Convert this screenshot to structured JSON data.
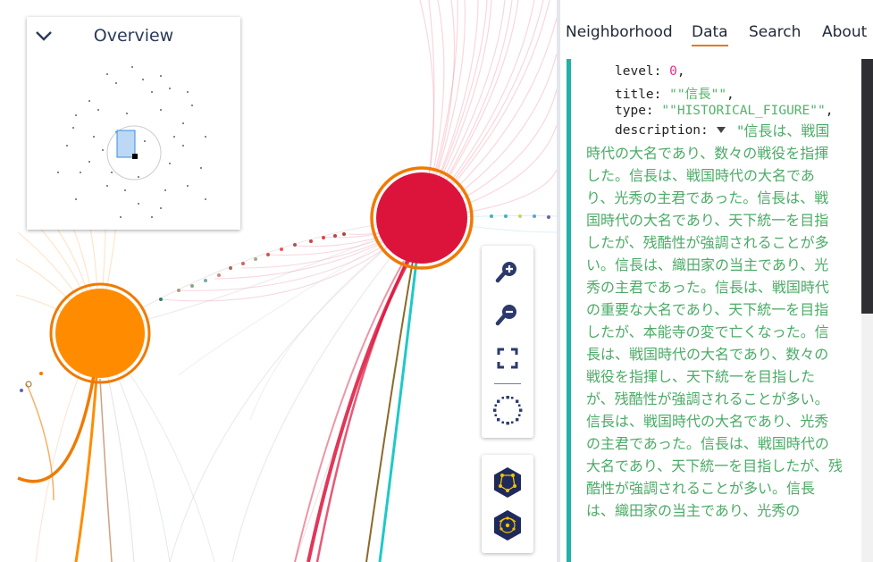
{
  "overview": {
    "title": "Overview",
    "collapse_icon": "chevron-down-icon"
  },
  "graph": {
    "nodes": [
      {
        "name": "orange-node",
        "color": "#ff8c00",
        "ring": "#f07a00"
      },
      {
        "name": "red-node",
        "color": "#dc143c",
        "ring": "#f07a00"
      }
    ]
  },
  "controls": {
    "zoom_in_icon": "zoom-in-icon",
    "zoom_out_icon": "zoom-out-icon",
    "fit_icon": "fit-screen-icon",
    "rotate_icon": "layout-spinner-icon",
    "layout1_icon": "force-layout-icon",
    "layout2_icon": "radial-layout-icon"
  },
  "tabs": [
    {
      "label": "Neighborhood",
      "active": false
    },
    {
      "label": "Data",
      "active": true
    },
    {
      "label": "Search",
      "active": false
    },
    {
      "label": "About",
      "active": false
    }
  ],
  "data_panel": {
    "level_key": "level:",
    "level_value": "0",
    "level_comma": ",",
    "title_key": "title:",
    "title_value": "\"\"信長\"\"",
    "title_comma": ",",
    "type_key": "type:",
    "type_value": "\"\"HISTORICAL_FIGURE\"\"",
    "type_comma": ",",
    "description_key": "description:",
    "description_value": "\"信長は、戦国時代の大名であり、数々の戦役を指揮した。信長は、戦国時代の大名であり、光秀の主君であった。信長は、戦国時代の大名であり、天下統一を目指したが、残酷性が強調されることが多い。信長は、織田家の当主であり、光秀の主君であった。信長は、戦国時代の重要な大名であり、天下統一を目指したが、本能寺の変で亡くなった。信長は、戦国時代の大名であり、数々の戦役を指揮し、天下統一を目指したが、残酷性が強調されることが多い。信長は、戦国時代の大名であり、光秀の主君であった。信長は、戦国時代の大名であり、天下統一を目指したが、残酷性が強調されることが多い。信長は、織田家の当主であり、光秀の"
  },
  "colors": {
    "accent": "#21b1a6",
    "tab_underline": "#e07a2b",
    "string_green": "#4cab67",
    "number_pink": "#e0308a",
    "icon_navy": "#2b3a6b"
  }
}
